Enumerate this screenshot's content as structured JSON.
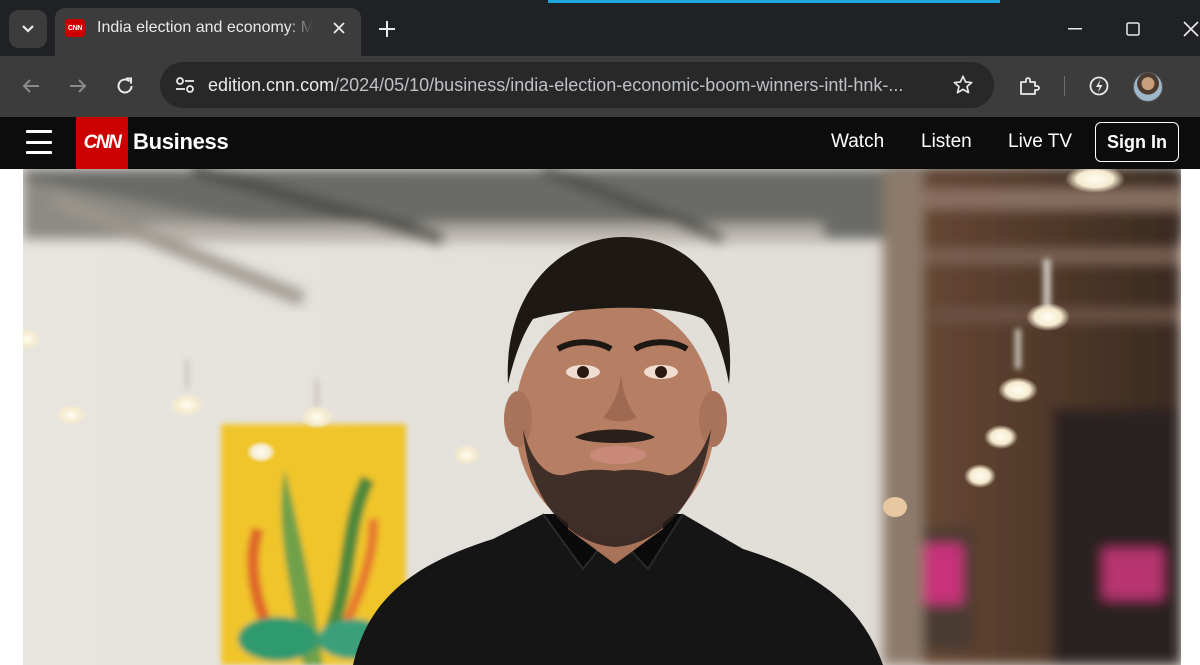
{
  "browser": {
    "tab": {
      "favicon_text": "CNN",
      "title": "India election and economy: Modi",
      "close_icon": "close-icon"
    },
    "new_tab_icon": "plus-icon",
    "window_controls": [
      "minimize-icon",
      "maximize-icon",
      "close-icon"
    ],
    "nav": [
      "back-arrow-icon",
      "forward-arrow-icon",
      "reload-icon"
    ],
    "url": {
      "host": "edition.cnn.com",
      "path": "/2024/05/10/business/india-election-economic-boom-winners-intl-hnk-..."
    },
    "toolbar_icons": [
      "bookmark-star-icon",
      "extensions-icon",
      "performance-icon",
      "profile-avatar"
    ]
  },
  "site": {
    "logo": "CNN",
    "section": "Business",
    "nav": [
      {
        "label": "Watch"
      },
      {
        "label": "Listen"
      },
      {
        "label": "Live TV"
      }
    ],
    "sign_in": "Sign In"
  },
  "colors": {
    "brand_red": "#cc0000",
    "header_bg": "#0c0c0c",
    "chrome_dark": "#202124",
    "chrome_toolbar": "#3c3c3c"
  }
}
